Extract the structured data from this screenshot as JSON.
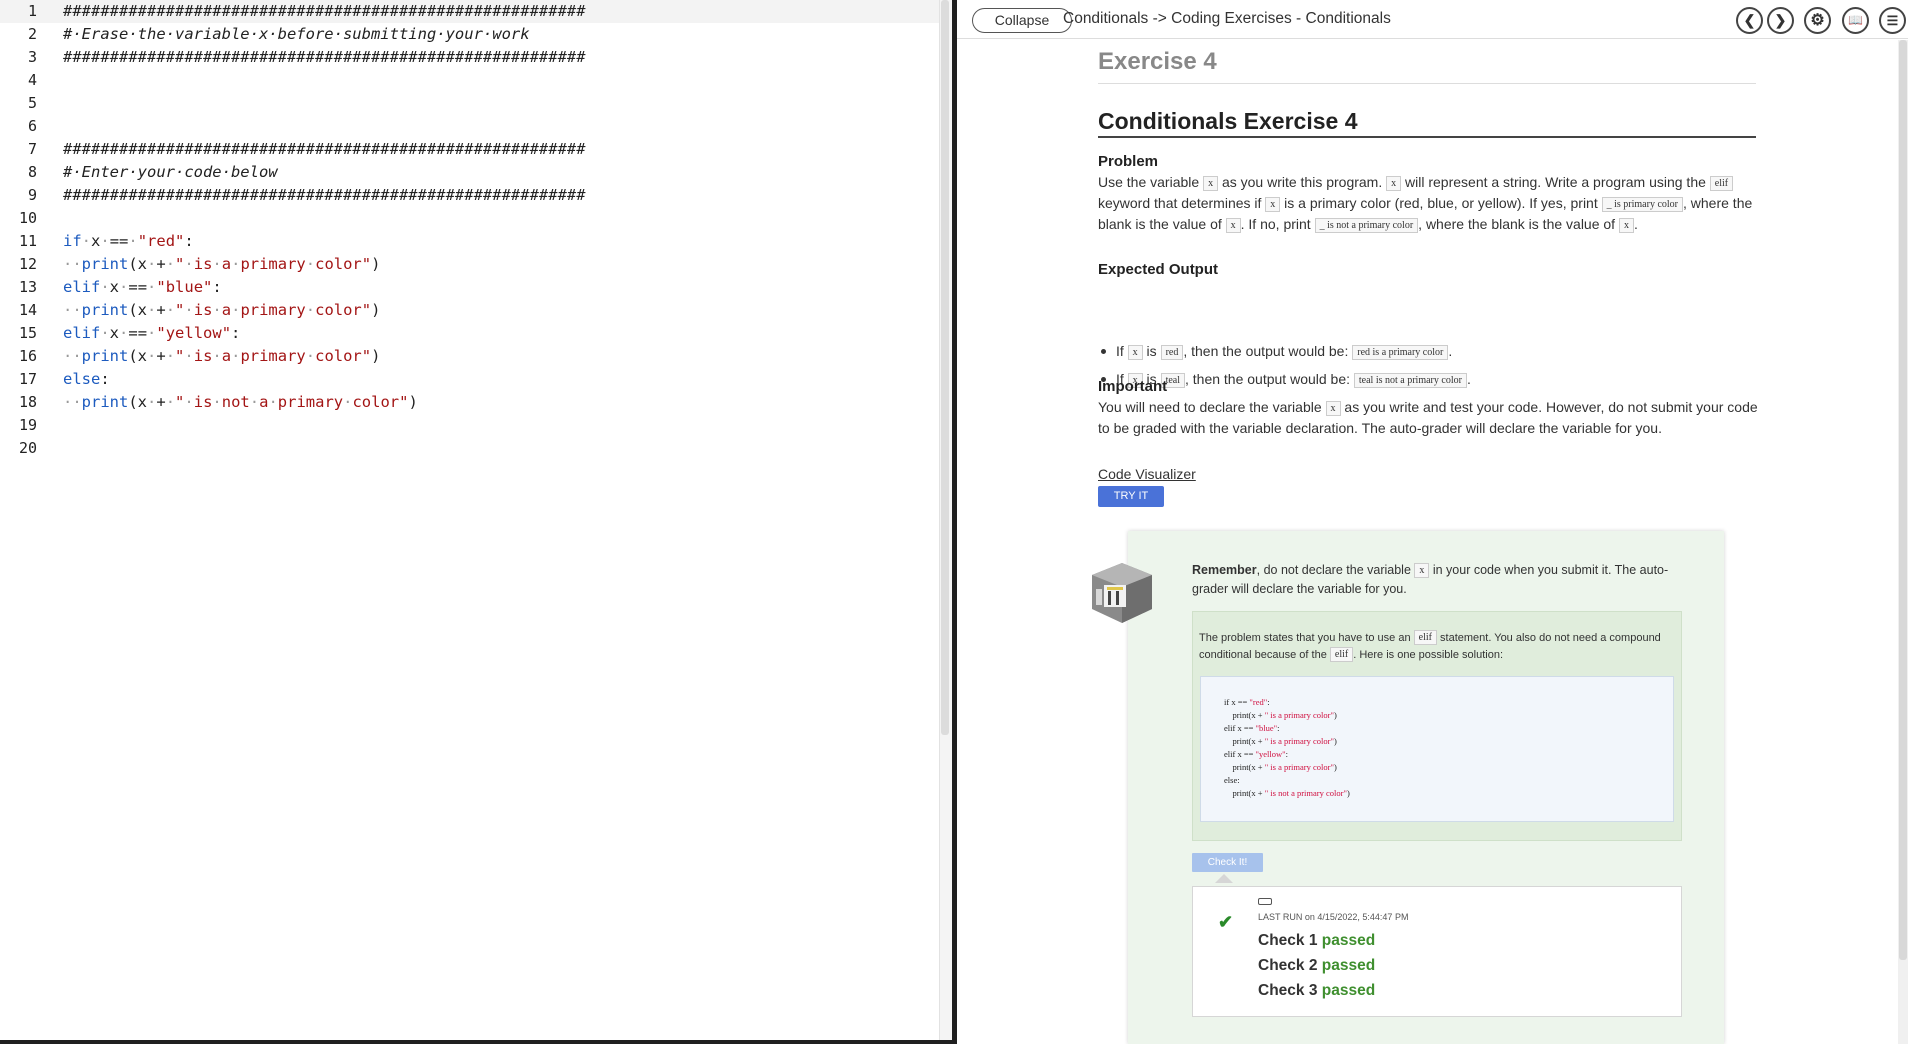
{
  "editor": {
    "lines": [
      "1",
      "2",
      "3",
      "4",
      "5",
      "6",
      "7",
      "8",
      "9",
      "10",
      "11",
      "12",
      "13",
      "14",
      "15",
      "16",
      "17",
      "18",
      "19",
      "20"
    ],
    "code": {
      "l1": "########################################################",
      "l2": "#·Erase·the·variable·x·before·submitting·your·work",
      "l3": "########################################################",
      "l7": "########################################################",
      "l8": "#·Enter·your·code·below",
      "l9": "########################################################"
    }
  },
  "topbar": {
    "collapse_label": "Collapse",
    "breadcrumb": "Conditionals -> Coding Exercises - Conditionals",
    "icons": [
      "chevron-left-icon",
      "chevron-right-icon",
      "gear-icon",
      "book-icon",
      "list-icon"
    ]
  },
  "exercise": {
    "heading": "Exercise 4",
    "title": "Conditionals Exercise 4",
    "problem_heading": "Problem",
    "problem": {
      "p1": "Use the variable ",
      "x": "x",
      "p2": " as you write this program. ",
      "p3": " will represent a string. Write a program using the ",
      "elif": "elif",
      "p4": " keyword that determines if ",
      "p5": " is a primary color (red, blue, or yellow). If yes, print ",
      "yes_code": "_ is primary color",
      "p6": ", where the blank is the value of ",
      "p7": ". If no, print ",
      "no_code": "_ is not a primary color",
      "p8": ", where the blank is the value of ",
      "p9": "."
    },
    "expected_heading": "Expected Output",
    "bullets": [
      {
        "a": "If ",
        "x": "x",
        "b": " is ",
        "val": "red",
        "c": ", then the output would be: ",
        "out": "red is a primary color",
        "d": "."
      },
      {
        "a": "If ",
        "x": "x",
        "b": " is ",
        "val": "teal",
        "c": ", then the output would be: ",
        "out": "teal is not a primary color",
        "d": "."
      }
    ],
    "important_heading": "Important",
    "important": {
      "p1": "You will need to declare the variable ",
      "x": "x",
      "p2": " as you write and test your code. However, do not submit your code to be graded with the variable declaration. The auto-grader will declare the variable for you."
    },
    "visualizer_link": "Code Visualizer",
    "try_label": "TRY IT"
  },
  "hint": {
    "bold": "Remember",
    "p1": ", do not declare the variable ",
    "x": "x",
    "p2": " in your code when you submit it. The auto-grader will declare the variable for you.",
    "intro_p1": "The problem states that you have to use an ",
    "elif": "elif",
    "intro_p2": " statement. You also do not need a compound conditional because of the ",
    "intro_p3": ". Here is one possible solution:",
    "code": {
      "c1": "if x == ",
      "s1": "\"red\"",
      "c1b": ":",
      "c2": "    print(x + ",
      "s2": "\" is a primary color\"",
      "c2b": ")",
      "c3": "elif x == ",
      "s3": "\"blue\"",
      "c3b": ":",
      "c4": "    print(x + ",
      "s4": "\" is a primary color\"",
      "c4b": ")",
      "c5": "elif x == ",
      "s5": "\"yellow\"",
      "c5b": ":",
      "c6": "    print(x + ",
      "s6": "\" is a primary color\"",
      "c6b": ")",
      "c7": "else:",
      "c8": "    print(x + ",
      "s8": "\" is not a primary color\"",
      "c8b": ")"
    }
  },
  "check": {
    "button_label": "Check It!",
    "last_run_label": "LAST RUN",
    "last_run_time": " on 4/15/2022, 5:44:47 PM",
    "results": [
      {
        "name": "Check 1",
        "status": "passed"
      },
      {
        "name": "Check 2",
        "status": "passed"
      },
      {
        "name": "Check 3",
        "status": "passed"
      }
    ]
  }
}
